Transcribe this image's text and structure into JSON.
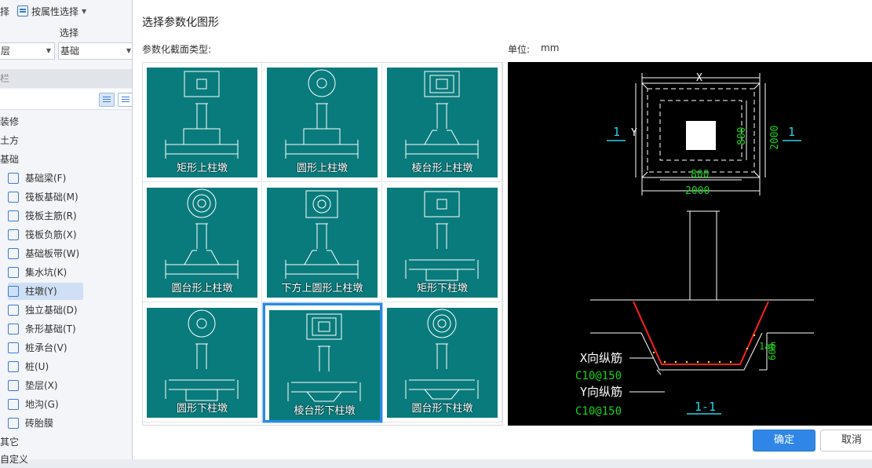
{
  "toolbar": {
    "top_left_label": "择",
    "select_by_attr": "按属性选择",
    "group_label": "选择"
  },
  "filters": {
    "floor_value": "层",
    "type_value": "基础"
  },
  "section_header": "栏",
  "tree": {
    "top_items": [
      "装修",
      "土方",
      "基础"
    ],
    "sub_items": [
      "基础梁(F)",
      "筏板基础(M)",
      "筏板主筋(R)",
      "筏板负筋(X)",
      "基础板带(W)",
      "集水坑(K)",
      "柱墩(Y)",
      "独立基础(D)",
      "条形基础(T)",
      "桩承台(V)",
      "桩(U)",
      "垫层(X)",
      "地沟(G)",
      "砖胎膜"
    ],
    "bottom_items": [
      "其它",
      "自定义"
    ]
  },
  "dialog": {
    "title": "选择参数化图形",
    "type_label": "参数化截面类型:",
    "unit_label": "单位:",
    "unit_value": "mm",
    "ok": "确定",
    "cancel": "取消"
  },
  "shapes": [
    {
      "label": "矩形上柱墩",
      "top": "rect",
      "side": "step"
    },
    {
      "label": "圆形上柱墩",
      "top": "circle",
      "side": "step"
    },
    {
      "label": "棱台形上柱墩",
      "top": "frustum",
      "side": "taper"
    },
    {
      "label": "圆台形上柱墩",
      "top": "circle2",
      "side": "taper"
    },
    {
      "label": "下方上圆形上柱墩",
      "top": "sqcircle",
      "side": "taper"
    },
    {
      "label": "矩形下柱墩",
      "top": "rect",
      "side": "stepdown"
    },
    {
      "label": "圆形下柱墩",
      "top": "circle",
      "side": "stepdown"
    },
    {
      "label": "棱台形下柱墩",
      "top": "frustum",
      "side": "taperdown"
    },
    {
      "label": "圆台形下柱墩",
      "top": "circle2",
      "side": "taperdown"
    }
  ],
  "selected_index": 7,
  "preview": {
    "dim_x": "X",
    "dim_y": "Y",
    "dim_800_right": "800",
    "dim_2000_right": "2000",
    "dim_800_bottom": "800",
    "dim_2000_bottom": "2000",
    "section_mark": "1",
    "dim_la": "1aE",
    "dim_600": "600",
    "x_bar_label": "X向纵筋",
    "x_bar_value": "C10@150",
    "y_bar_label": "Y向纵筋",
    "y_bar_value": "C10@150",
    "section_title": "1-1"
  },
  "colors": {
    "tile_bg": "#0a7b7c",
    "accent": "#2f86e6",
    "preview_green": "#19d219",
    "preview_cyan": "#27d6e8",
    "rebar_red": "#ff2020"
  }
}
